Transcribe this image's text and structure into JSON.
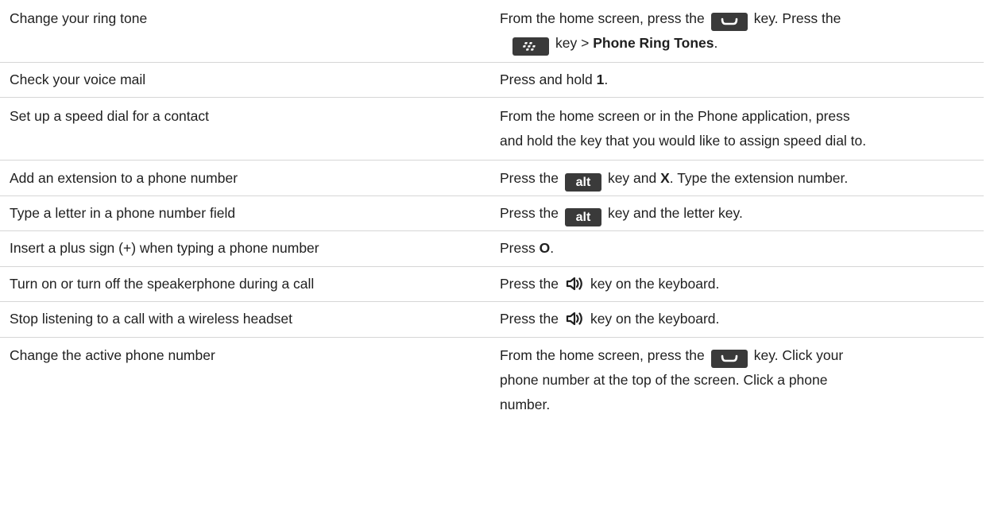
{
  "rows": [
    {
      "task": "Change your ring tone",
      "step": {
        "p1": "From the home screen, press the",
        "p2": "key. Press the",
        "p3": "key >",
        "b1": "Phone Ring Tones",
        "p4": "."
      }
    },
    {
      "task": "Check your voice mail",
      "step": {
        "p1": "Press and hold",
        "b1": "1",
        "p2": "."
      }
    },
    {
      "task": "Set up a speed dial for a contact",
      "step": {
        "line1": "From the home screen or in the Phone application, press",
        "line2": "and hold the key that you would like to assign speed dial to."
      }
    },
    {
      "task": "Add an extension to a phone number",
      "step": {
        "p1": "Press the",
        "p2": "key and",
        "b1": "X",
        "p3": ". Type the extension number."
      }
    },
    {
      "task": "Type a letter in a phone number field",
      "step": {
        "p1": "Press the",
        "p2": "key and the letter key."
      }
    },
    {
      "task": "Insert a plus sign (+) when typing a phone number",
      "step": {
        "p1": "Press",
        "b1": "O",
        "p2": "."
      }
    },
    {
      "task": "Turn on or turn off the speakerphone during a call",
      "step": {
        "p1": "Press the",
        "p2": "key on the keyboard."
      }
    },
    {
      "task": "Stop listening to a call with a wireless headset",
      "step": {
        "p1": "Press the",
        "p2": "key on the keyboard."
      }
    },
    {
      "task": "Change the active phone number",
      "step": {
        "p1": "From the home screen, press the",
        "p2": "key. Click your",
        "line2": "phone number at the top of the screen. Click a phone",
        "line3": "number."
      }
    }
  ],
  "keys": {
    "alt_label": "alt",
    "send_icon": "send-key-icon",
    "menu_icon": "menu-key-icon",
    "speaker_icon": "speakerphone-key-icon"
  },
  "colors": {
    "key_bg": "#3a3a3a",
    "divider": "#d6d6d6",
    "text": "#1f1f1f"
  }
}
